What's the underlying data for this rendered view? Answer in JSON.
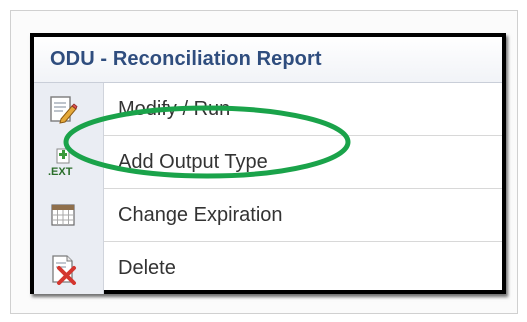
{
  "menu": {
    "title": "ODU - Reconciliation Report",
    "items": [
      {
        "label": "Modify / Run",
        "icon": "modify-run-icon"
      },
      {
        "label": "Add Output Type",
        "icon": "add-output-type-icon",
        "icon_text": ".EXT"
      },
      {
        "label": "Change Expiration",
        "icon": "calendar-icon"
      },
      {
        "label": "Delete",
        "icon": "delete-icon"
      }
    ]
  },
  "annotation": {
    "shape": "ellipse",
    "color": "#1aa34a",
    "target": "Add Output Type"
  }
}
